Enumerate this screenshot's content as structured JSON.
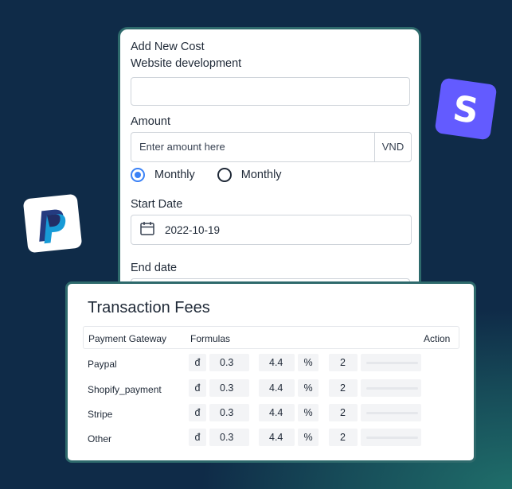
{
  "form": {
    "title": "Add New Cost",
    "name_label": "Website development",
    "name_value": "",
    "amount_label": "Amount",
    "amount_placeholder": "Enter amount here",
    "currency": "VND",
    "frequency_options": [
      {
        "label": "Monthly",
        "selected": true
      },
      {
        "label": "Monthly",
        "selected": false
      }
    ],
    "start_date_label": "Start Date",
    "start_date_value": "2022-10-19",
    "end_date_label": "End date"
  },
  "fees": {
    "title": "Transaction Fees",
    "headers": {
      "gateway": "Payment Gateway",
      "formulas": "Formulas",
      "action": "Action"
    },
    "rows": [
      {
        "gateway": "Paypal",
        "symbol": "đ",
        "fixed": "0.3",
        "percent": "4.4",
        "percent_sign": "%",
        "count": "2"
      },
      {
        "gateway": "Shopify_payment",
        "symbol": "đ",
        "fixed": "0.3",
        "percent": "4.4",
        "percent_sign": "%",
        "count": "2"
      },
      {
        "gateway": "Stripe",
        "symbol": "đ",
        "fixed": "0.3",
        "percent": "4.4",
        "percent_sign": "%",
        "count": "2"
      },
      {
        "gateway": "Other",
        "symbol": "đ",
        "fixed": "0.3",
        "percent": "4.4",
        "percent_sign": "%",
        "count": "2"
      }
    ]
  },
  "logos": {
    "paypal": {
      "icon": "paypal-logo-icon",
      "dark": "#253b80",
      "light": "#179bd7"
    },
    "stripe": {
      "icon": "stripe-logo-icon",
      "bg": "#635bff",
      "letter": "S"
    }
  },
  "colors": {
    "accent": "#3b82f6",
    "card_border": "#2e6a6c",
    "background": "#0f2b48"
  }
}
